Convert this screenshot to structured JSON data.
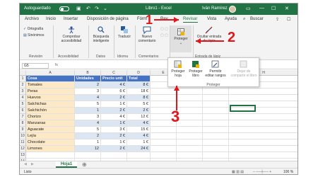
{
  "titlebar": {
    "autosave": "Autoguardado",
    "filename": "Libro1 - Excel",
    "user": "Iván Ramírez"
  },
  "tabs": [
    "Archivo",
    "Inicio",
    "Insertar",
    "Disposición de página",
    "Fórm",
    "Rev",
    "Revisar",
    "Vista",
    "Ayuda",
    "Buscar"
  ],
  "ribbon": {
    "ortografia": "Ortografía",
    "sinonimos": "Sinónimos",
    "revision": "Revisión",
    "comprobar": "Comprobar accesibilidad",
    "accesibilidad": "Accesibilidad",
    "busqueda": "Búsqueda inteligente",
    "datos": "Datos",
    "traducir": "Traducir",
    "idioma": "Idioma",
    "nuevo_comentario": "Nuevo comentario",
    "comentarios": "Comentarios",
    "proteger": "Proteger",
    "ocultar_entrada": "Ocultar entrada de lápiz",
    "entrada_lapiz": "Entrada de lápiz"
  },
  "dropdown": {
    "proteger_hoja": "Proteger hoja",
    "proteger_libro": "Proteger libro",
    "permitir": "Permitir editar rangos",
    "dejar": "Dejar de compartir el libro",
    "group": "Proteger"
  },
  "formula": {
    "namebox": "G5",
    "fx": "fx"
  },
  "columns": [
    "A",
    "B",
    "C",
    "D",
    "E",
    "F",
    "G",
    "H"
  ],
  "table": {
    "headers": [
      "Cosa",
      "Unidades",
      "Precio unit",
      "Total"
    ],
    "rows": [
      [
        "Tomates",
        "2",
        "4 €",
        "8 €"
      ],
      [
        "Peras",
        "3",
        "6 €",
        "18 €"
      ],
      [
        "Huevos",
        "4",
        "2 €",
        "8 €"
      ],
      [
        "Salchichas",
        "5",
        "1 €",
        "5 €"
      ],
      [
        "Salchichón",
        "1",
        "2 €",
        "2 €"
      ],
      [
        "Chorizo",
        "3",
        "4 €",
        "12 €"
      ],
      [
        "Manzanas",
        "4",
        "1 €",
        "4 €"
      ],
      [
        "Aguacate",
        "5",
        "3 €",
        "15 €"
      ],
      [
        "Lejía",
        "2",
        "2 €",
        "4 €"
      ],
      [
        "Chocolate",
        "1",
        "1 €",
        "1 €"
      ],
      [
        "Limones",
        "12",
        "2 €",
        "24 €"
      ]
    ]
  },
  "sheet": {
    "tab": "Hoja1"
  },
  "status": {
    "left": "Listo",
    "zoom": "100 %"
  },
  "annotations": [
    "1",
    "2",
    "3"
  ],
  "colors": {
    "excel_green": "#217346",
    "annotation_red": "#e0161b",
    "table_header": "#4472c4"
  }
}
